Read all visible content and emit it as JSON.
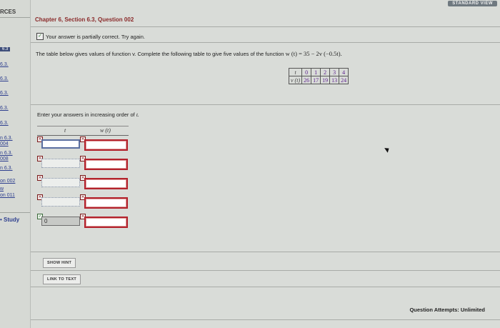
{
  "header": {
    "standard_view_label": "STANDARD VIEW"
  },
  "sidebar": {
    "title": "RCES",
    "badge": "6.3",
    "links": [
      "6.3.",
      "6.3.",
      "6.3.",
      "6.3.",
      "6.3.",
      "n 6.3.",
      "004",
      "n 6.3.",
      "008",
      "n 6.3.",
      "on 002",
      "w",
      "on 011"
    ],
    "study_label": "Study"
  },
  "question": {
    "heading": "Chapter 6, Section 6.3, Question 002",
    "status_text": "Your answer is partially correct.  Try again.",
    "prompt_text": "The table below gives values of function v. Complete the following table to give five values of the function",
    "prompt_formula": "w (t) = 35 − 2v (−0.5t)."
  },
  "value_table": {
    "row_labels": [
      "t",
      "v (t)"
    ],
    "t_values": [
      "0",
      "1",
      "2",
      "3",
      "4"
    ],
    "v_values": [
      "26",
      "17",
      "19",
      "13",
      "24"
    ]
  },
  "answer": {
    "instruction": "Enter your answers in increasing order of",
    "instruction_var": "t.",
    "col_t": "t",
    "col_w": "w (t)",
    "last_t_value": "0"
  },
  "buttons": {
    "show_hint": "SHOW HINT",
    "link_to_text": "LINK TO TEXT"
  },
  "footer": {
    "attempts": "Question Attempts: Unlimited"
  },
  "colors": {
    "error_border": "#b3222c",
    "heading": "#8a2a2a",
    "table_values": "#5c1f8e"
  }
}
